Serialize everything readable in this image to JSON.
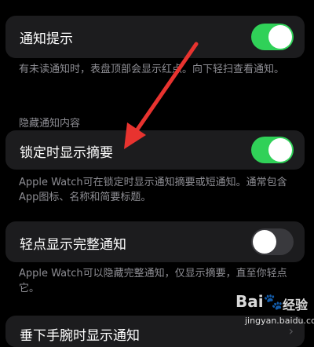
{
  "settings": {
    "notification_alert": {
      "label": "通知提示",
      "enabled": true,
      "footnote": "有未读通知时，表盘顶部会显示红点。向下轻扫查看通知。"
    },
    "hide_section": {
      "header": "隐藏通知内容"
    },
    "summary_when_locked": {
      "label": "锁定时显示摘要",
      "enabled": true,
      "footnote": "Apple Watch可在锁定时显示通知摘要或短通知。通常包含App图标、名称和简要标题。"
    },
    "tap_full_notification": {
      "label": "轻点显示完整通知",
      "enabled": false,
      "footnote": "Apple Watch可以隐藏完整通知，仅显示摘要，直至你轻点它。"
    },
    "wrist_down": {
      "label": "垂下手腕时显示通知"
    }
  },
  "watermark": {
    "logo": "Bai",
    "logo_paw": "🐾",
    "brand": "经验",
    "url": "jingyan.baidu.com"
  },
  "colors": {
    "toggle_on": "#30d158",
    "toggle_off": "#39393d",
    "card": "#1c1c1e",
    "annotation_arrow": "#e8332f"
  }
}
